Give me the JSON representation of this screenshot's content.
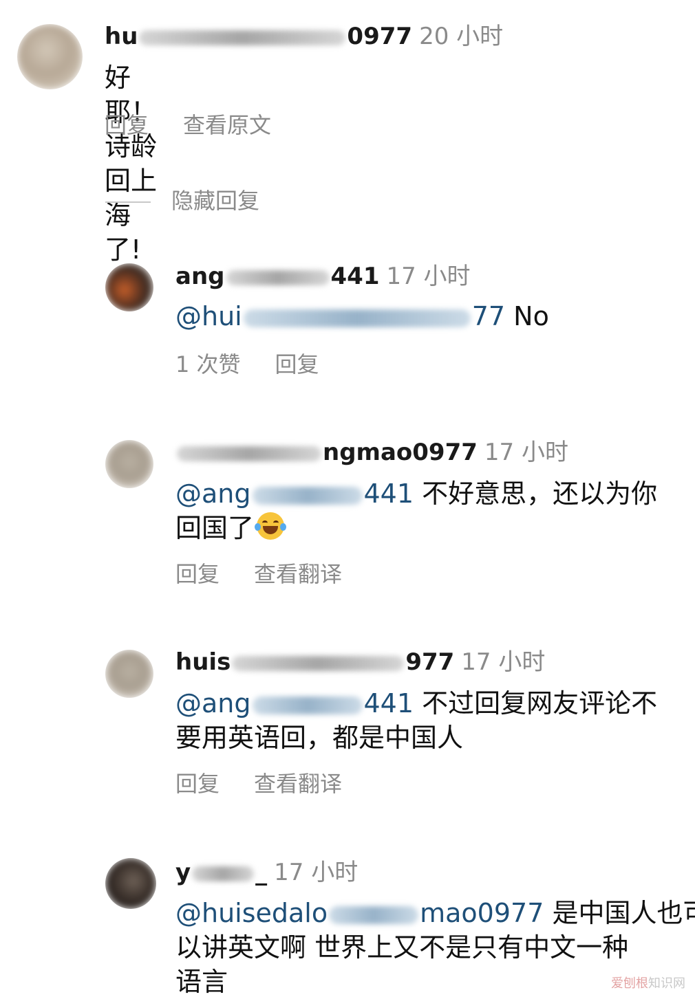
{
  "comments": [
    {
      "username_start": "hu",
      "username_end": "0977",
      "time": "20 小时",
      "mention": "",
      "text": "好耶！诗龄回上海了!",
      "text_line2": "",
      "actions": {
        "likes": "",
        "reply": "回复",
        "translate": "查看原文"
      }
    },
    {
      "username_start": "ang",
      "username_end": "441",
      "time": "17 小时",
      "mention": "@hui",
      "mention_end": "77",
      "text": " No",
      "text_line2": "",
      "actions": {
        "likes": "1 次赞",
        "reply": "回复",
        "translate": ""
      }
    },
    {
      "username_start": "",
      "username_end": "ngmao0977",
      "time": "17 小时",
      "mention": "@ang",
      "mention_end": "441",
      "text": " 不好意思，还以为你",
      "text_line2": "回国了",
      "actions": {
        "likes": "",
        "reply": "回复",
        "translate": "查看翻译"
      }
    },
    {
      "username_start": "huis",
      "username_end": "977",
      "time": "17 小时",
      "mention": "@ang",
      "mention_end": "441",
      "text": " 不过回复网友评论不",
      "text_line2": "要用英语回，都是中国人",
      "actions": {
        "likes": "",
        "reply": "回复",
        "translate": "查看翻译"
      }
    },
    {
      "username_start": "y",
      "username_end": "_",
      "time": "17 小时",
      "mention": "@huisedalo",
      "mention_end": "mao0977",
      "text": " 是中国人也可",
      "text_line2": "以讲英文啊 世界上又不是只有中文一种",
      "text_line3": "语言",
      "actions": {
        "likes": "",
        "reply": "",
        "translate": ""
      }
    }
  ],
  "hide_replies_label": "隐藏回复",
  "emoji_name": "tears-of-joy-emoji",
  "watermark": {
    "brand": "爱刨根",
    "suffix": "知识网"
  },
  "colors": {
    "mention": "#1e4f78",
    "muted": "#8a8a8a",
    "text": "#111111"
  }
}
